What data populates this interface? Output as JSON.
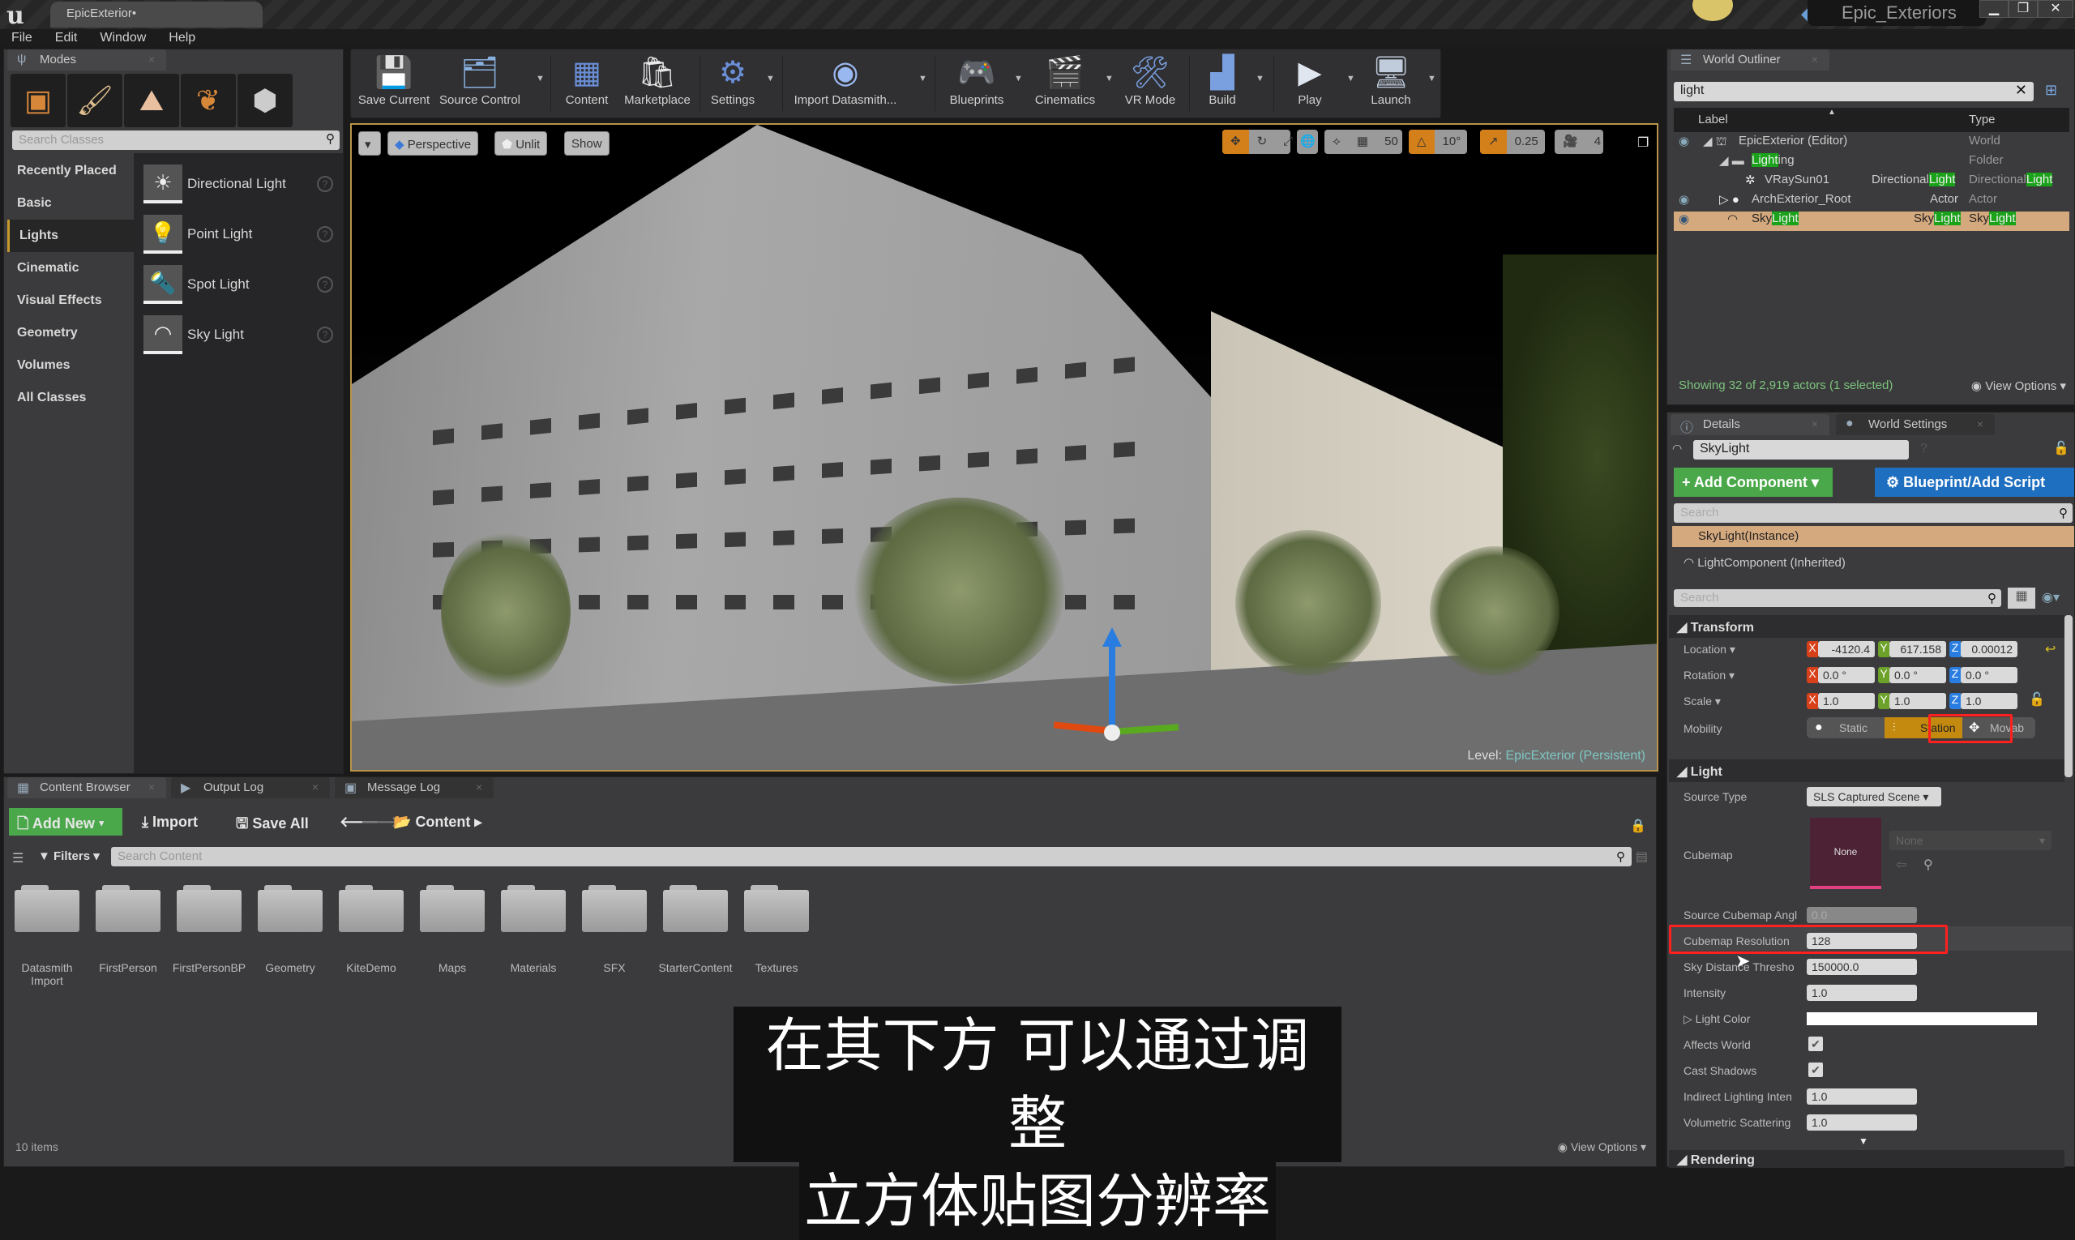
{
  "titlebar": {
    "doc_tab": "EpicExterior•",
    "project": "Epic_Exteriors",
    "minimize": "▁",
    "maximize": "❐",
    "close": "✕"
  },
  "menu": [
    "File",
    "Edit",
    "Window",
    "Help"
  ],
  "modes": {
    "tab": "Modes",
    "mode_icons": [
      "place-icon",
      "paint-icon",
      "landscape-icon",
      "foliage-icon",
      "geometry-edit-icon"
    ],
    "search_placeholder": "Search Classes",
    "categories": [
      "Recently Placed",
      "Basic",
      "Lights",
      "Cinematic",
      "Visual Effects",
      "Geometry",
      "Volumes",
      "All Classes"
    ],
    "selected_category": "Lights",
    "items": [
      {
        "label": "Directional Light",
        "icon": "☀"
      },
      {
        "label": "Point Light",
        "icon": "💡"
      },
      {
        "label": "Spot Light",
        "icon": "🔦"
      },
      {
        "label": "Sky Light",
        "icon": "◠"
      }
    ]
  },
  "toolbar": {
    "buttons": [
      {
        "label": "Save Current",
        "icon": "💾"
      },
      {
        "label": "Source Control",
        "icon": "🗂"
      },
      {
        "label": "Content",
        "icon": "▦"
      },
      {
        "label": "Marketplace",
        "icon": "🛍"
      },
      {
        "label": "Settings",
        "icon": "⚙"
      },
      {
        "label": "Import Datasmith...",
        "icon": "◉"
      },
      {
        "label": "Blueprints",
        "icon": "🎮"
      },
      {
        "label": "Cinematics",
        "icon": "🎬"
      },
      {
        "label": "VR Mode",
        "icon": "🛠"
      },
      {
        "label": "Build",
        "icon": "▟"
      },
      {
        "label": "Play",
        "icon": "▶"
      },
      {
        "label": "Launch",
        "icon": "🖥"
      }
    ]
  },
  "viewport": {
    "menu_arrow": "▾",
    "perspective": "Perspective",
    "unlit": "Unlit",
    "show": "Show",
    "grid_snap": "50",
    "rotation_snap": "10°",
    "scale_snap": "0.25",
    "camera_speed": "4",
    "level_label": "Level:",
    "level_name": "EpicExterior (Persistent)"
  },
  "outliner": {
    "tab": "World Outliner",
    "search_value": "light",
    "col_label": "Label",
    "col_type": "Type",
    "rows": [
      {
        "name": "EpicExterior (Editor)",
        "type": "World",
        "visible": true,
        "selected": false
      },
      {
        "name_pre": "",
        "name_hl": "Light",
        "name_post": "ing",
        "type": "Folder",
        "visible": false,
        "selected": false
      },
      {
        "name": "VRaySun01",
        "type_pre": "Directional",
        "type_hl": "Light",
        "visible": false,
        "selected": false
      },
      {
        "name": "ArchExterior_Root",
        "type": "Actor",
        "visible": true,
        "selected": false
      },
      {
        "name_pre": "Sky",
        "name_hl": "Light",
        "type_pre": "Sky",
        "type_hl": "Light",
        "visible": true,
        "selected": true
      }
    ],
    "status": "Showing 32 of 2,919 actors (1 selected)",
    "view_options": "View Options"
  },
  "details": {
    "tab": "Details",
    "tab2": "World Settings",
    "actor_name": "SkyLight",
    "add_component": "+ Add Component ▾",
    "blueprint": "Blueprint/Add Script",
    "search_placeholder": "Search",
    "instance": "SkyLight(Instance)",
    "component": "LightComponent (Inherited)",
    "transform": {
      "title": "Transform",
      "location_label": "Location ▾",
      "location": [
        "-4120.4",
        "617.158",
        "0.00012"
      ],
      "rotation_label": "Rotation ▾",
      "rotation": [
        "0.0 °",
        "0.0 °",
        "0.0 °"
      ],
      "scale_label": "Scale ▾",
      "scale": [
        "1.0",
        "1.0",
        "1.0"
      ],
      "mobility_label": "Mobility",
      "mobility_options": [
        "Static",
        "Station",
        "Movab"
      ],
      "mobility_selected": "Station"
    },
    "light": {
      "title": "Light",
      "source_type_label": "Source Type",
      "source_type": "SLS Captured Scene",
      "cubemap_label": "Cubemap",
      "cubemap_thumb": "None",
      "cubemap_value": "None",
      "source_angle_label": "Source Cubemap Angl",
      "source_angle": "0.0",
      "resolution_label": "Cubemap Resolution",
      "resolution": "128",
      "sky_distance_label": "Sky Distance Thresho",
      "sky_distance": "150000.0",
      "intensity_label": "Intensity",
      "intensity": "1.0",
      "light_color_label": "Light Color",
      "light_color": "#ffffff",
      "affects_world_label": "Affects World",
      "affects_world": true,
      "cast_shadows_label": "Cast Shadows",
      "cast_shadows": true,
      "indirect_label": "Indirect Lighting Inten",
      "indirect": "1.0",
      "volumetric_label": "Volumetric Scattering",
      "volumetric": "1.0"
    },
    "rendering_title": "Rendering"
  },
  "content_browser": {
    "tabs": [
      "Content Browser",
      "Output Log",
      "Message Log"
    ],
    "add_new": "Add New ▾",
    "import": "Import",
    "save_all": "Save All",
    "path": "Content",
    "filters": "Filters ▾",
    "search_placeholder": "Search Content",
    "folders": [
      "Datasmith Import",
      "FirstPerson",
      "FirstPersonBP",
      "Geometry",
      "KiteDemo",
      "Maps",
      "Materials",
      "SFX",
      "StarterContent",
      "Textures"
    ],
    "item_count": "10 items",
    "view_options": "View Options ▾"
  },
  "subtitle": {
    "line1": "在其下方 可以通过调整",
    "line2": "立方体贴图分辨率"
  },
  "colors": {
    "accent": "#d4801a",
    "selection": "#d5a97e",
    "highlight": "#1aa31a",
    "add_green": "#4aa84a",
    "blueprint_blue": "#1f6fc0",
    "annotation_red": "#ff2020"
  }
}
